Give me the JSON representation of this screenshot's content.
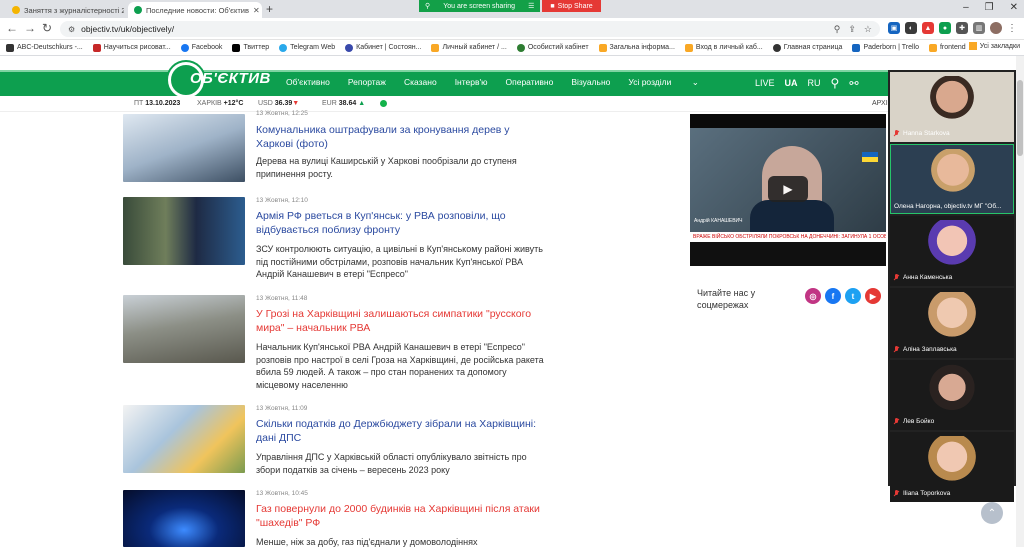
{
  "browser": {
    "tabs": [
      {
        "title": "Заняття з журналістерності 23 ...",
        "active": false
      },
      {
        "title": "Последние новости: Об'єктив",
        "active": true
      }
    ],
    "url": "objectiv.tv/uk/objectively/",
    "screen_sharing": {
      "status": "You are screen sharing",
      "stop": "Stop Share"
    },
    "bookmarks": [
      "ABC-Deutschkurs -...",
      "Научиться рисоват...",
      "Facebook",
      "Твиттер",
      "Telegram Web",
      "Кабинет | Состоян...",
      "Личный кабинет / ...",
      "Особистий кабінет",
      "Загальна інформа...",
      "Вход в личный каб...",
      "Главная страница",
      "Paderborn | Trello",
      "frontend"
    ],
    "bookmarks_right": "Усі закладки"
  },
  "site": {
    "logo_text": "ОБ'ЄКТИВ",
    "menu": [
      "Об'єктивно",
      "Репортаж",
      "Сказано",
      "Інтерв'ю",
      "Оперативно",
      "Візуально",
      "Усі розділи"
    ],
    "right_nav": {
      "live": "LIVE",
      "ua": "UA",
      "ru": "RU"
    },
    "info": {
      "date_prefix": "ПТ",
      "date": "13.10.2023",
      "city": "ХАРКІВ",
      "temp": "+12°C",
      "usd_label": "USD",
      "usd_value": "36.39",
      "eur_label": "EUR",
      "eur_value": "38.64"
    },
    "archive": "АРХІ"
  },
  "articles": [
    {
      "date": "13 Жовтня, 12:25",
      "title": "Комунальника оштрафували за кронування дерев у Харкові (фото)",
      "desc": "Дерева на вулиці Каширській у Харкові пообрізали до ступеня припинення росту.",
      "red": false
    },
    {
      "date": "13 Жовтня, 12:10",
      "title": "Армія РФ рветься в Куп'янськ: у РВА розповіли, що відбувається поблизу фронту",
      "desc": "ЗСУ контролюють ситуацію, а цивільні в Куп'янському районі живуть під постійними обстрілами, розповів начальник Куп'янської РВА Андрій Канашевич в етері \"Еспресо\"",
      "red": false
    },
    {
      "date": "13 Жовтня, 11:48",
      "title": "У Грозі на Харківщині залишаються симпатики \"русского мира\" – начальник РВА",
      "desc": "Начальник Куп'янської РВА Андрій Канашевич в етері \"Еспресо\" розповів про настрої в селі Гроза на Харківщині, де російська ракета вбила 59 людей. А також – про стан поранених та допомогу місцевому населенню",
      "red": true
    },
    {
      "date": "13 Жовтня, 11:09",
      "title": "Скільки податків до Держбюджету зібрали на Харківщині: дані ДПС",
      "desc": "Управління ДПС у Харківській області опублікувало звітність про збори податків за січень – вересень 2023 року",
      "red": false
    },
    {
      "date": "13 Жовтня, 10:45",
      "title": "Газ повернули до 2000 будинків на Харківщині після атаки \"шахедів\" РФ",
      "desc": "Менше, ніж за добу, газ під'єднали у домоволодіннях",
      "red": true
    }
  ],
  "sidebar": {
    "video": {
      "person": "Андрій КАНАШЕВИЧ",
      "ticker": "ВРАЖЕ ВІЙСЬКО ОБСТРІЛЯЛИ ПОКРОВСЬК НА ДОНЕЧЧИНІ: ЗАГИНУЛА 1 ОСОБА",
      "channel": "5"
    },
    "read_us": "Читайте нас у соцмережах"
  },
  "participants": [
    {
      "name": "Hanna Starkova"
    },
    {
      "name": "Олена Нагорна, objectiv.tv МГ \"Об..."
    },
    {
      "name": "Анна Каменська"
    },
    {
      "name": "Аліна Заплавська"
    },
    {
      "name": "Лев Бойко"
    },
    {
      "name": "Iliana Toporkova"
    }
  ],
  "colors": {
    "brand": "#0d9f4f",
    "link": "#2b4aa0",
    "accent": "#e53935"
  }
}
